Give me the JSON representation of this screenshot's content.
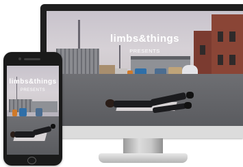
{
  "monitor": {
    "brand_title": "limbs&things",
    "subtitle": "PRESENTS"
  },
  "phone": {
    "brand_title": "limbs&things",
    "subtitle": "PRESENTS"
  },
  "colors": {
    "device_frame": "#1f1f1f",
    "monitor_chin": "#dcdcdc",
    "brick_building": "#7b3b30",
    "overlay_text": "#ffffff"
  }
}
